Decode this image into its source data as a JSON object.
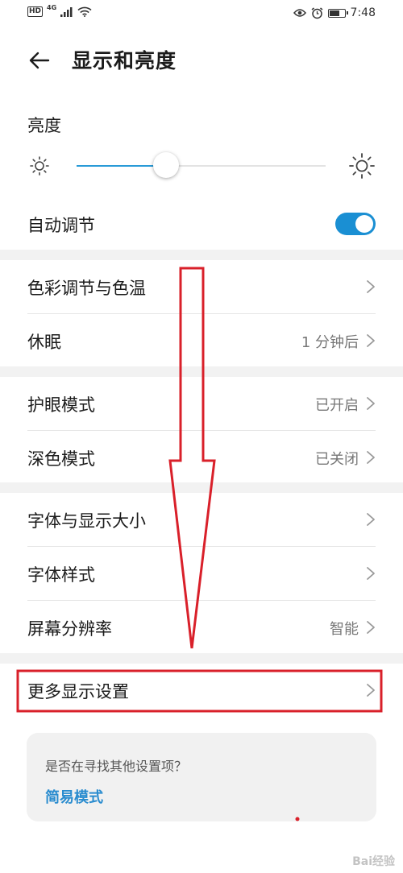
{
  "status_bar": {
    "hd": "HD",
    "network": "4G",
    "time": "7:48",
    "icons": [
      "signal-icon",
      "wifi-icon",
      "eye-comfort-icon",
      "alarm-icon",
      "battery-icon"
    ]
  },
  "header": {
    "title": "显示和亮度",
    "back_icon": "back-arrow-icon"
  },
  "brightness": {
    "label": "亮度",
    "level": 0.36,
    "accent": "#2a9bd7",
    "auto_label": "自动调节",
    "auto_on": true
  },
  "sections": [
    [
      {
        "label": "色彩调节与色温",
        "value": ""
      },
      {
        "label": "休眠",
        "value": "1 分钟后"
      }
    ],
    [
      {
        "label": "护眼模式",
        "value": "已开启"
      },
      {
        "label": "深色模式",
        "value": "已关闭"
      }
    ],
    [
      {
        "label": "字体与显示大小",
        "value": ""
      },
      {
        "label": "字体样式",
        "value": ""
      },
      {
        "label": "屏幕分辨率",
        "value": "智能"
      }
    ],
    [
      {
        "label": "更多显示设置",
        "value": ""
      }
    ]
  ],
  "hint": {
    "question": "是否在寻找其他设置项？",
    "link": "简易模式",
    "link_color": "#2a8ccf"
  },
  "annotation_color": "#d9202a",
  "watermark": "Bai经验"
}
